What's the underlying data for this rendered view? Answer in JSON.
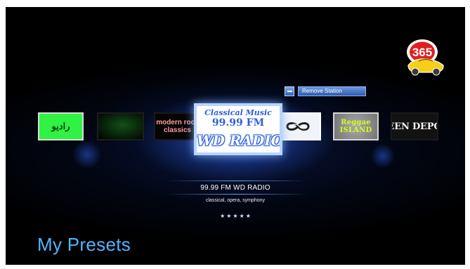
{
  "header": {
    "logo_text": "365"
  },
  "actions": {
    "remove_station_label": "Remove Station"
  },
  "carousel": {
    "tiles": [
      {
        "text": "‫راديو‬"
      },
      {
        "text": ""
      },
      {
        "text_line_1": "modern rock",
        "text_line_2": "classics"
      },
      {
        "genre": "Classical Music",
        "frequency": "99.99 FM",
        "name": "WD RADIO"
      },
      {
        "symbol": "infinity-pair"
      },
      {
        "text_line_1": "Reggae",
        "text_line_2": "ISLAND"
      },
      {
        "text": "TEEN DEPOT"
      }
    ]
  },
  "station_info": {
    "title": "99.99 FM WD RADIO",
    "genres": "classical, opera, symphony",
    "rating": 5
  },
  "footer": {
    "title": "My Presets"
  },
  "colors": {
    "accent": "#52b4ff",
    "selected_border": "#b7d5ff",
    "button": "#3f72cb",
    "background": "#000000"
  }
}
